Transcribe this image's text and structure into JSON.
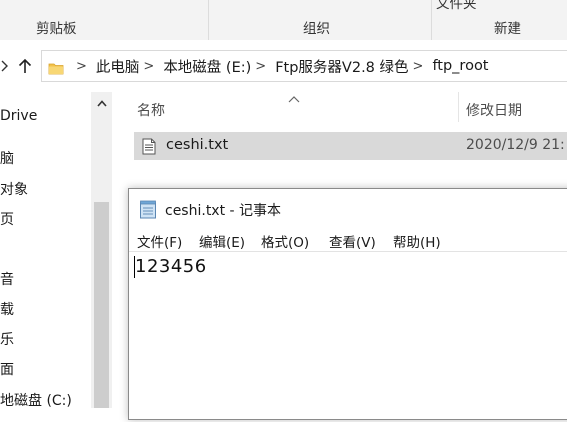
{
  "ribbon": {
    "groups": [
      "剪贴板",
      "组织",
      "新建"
    ],
    "partial_top_label": "文件夹"
  },
  "address_bar": {
    "crumbs": [
      "此电脑",
      "本地磁盘 (E:)",
      "Ftp服务器V2.8 绿色",
      "ftp_root"
    ]
  },
  "nav_pane": {
    "items": [
      "Drive",
      "脑",
      "对象",
      "页",
      "",
      "音",
      "载",
      "乐",
      "面",
      "地磁盘 (C:)"
    ]
  },
  "file_list": {
    "columns": {
      "name": "名称",
      "modified": "修改日期"
    },
    "rows": [
      {
        "name": "ceshi.txt",
        "modified": "2020/12/9 21:"
      }
    ]
  },
  "notepad": {
    "title": "ceshi.txt - 记事本",
    "menu": [
      "文件(F)",
      "编辑(E)",
      "格式(O)",
      "查看(V)",
      "帮助(H)"
    ],
    "content": "123456"
  }
}
